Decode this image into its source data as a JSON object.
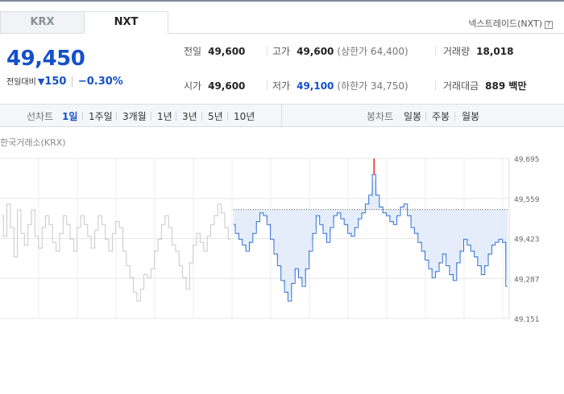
{
  "tabs": [
    {
      "label": "KRX",
      "active": false
    },
    {
      "label": "NXT",
      "active": true
    }
  ],
  "nxt_link": "넥스트레이드(NXT)",
  "help_icon_glyph": "?",
  "quote": {
    "price": "49,450",
    "change_label": "전일대비",
    "change_arrow": "▼",
    "change_amount": "150",
    "change_pct": "−0.30%",
    "color": "#1450c9"
  },
  "stats": {
    "prev_close": {
      "label": "전일",
      "value": "49,600"
    },
    "high": {
      "label": "고가",
      "value": "49,600",
      "sub": "(상한가 64,400)"
    },
    "volume": {
      "label": "거래량",
      "value": "18,018"
    },
    "open": {
      "label": "시가",
      "value": "49,600"
    },
    "low": {
      "label": "저가",
      "value": "49,100",
      "sub": "(하한가 34,750)"
    },
    "amount": {
      "label": "거래대금",
      "value": "889 백만"
    }
  },
  "controls": {
    "line_label": "선차트",
    "line_periods": [
      "1일",
      "1주일",
      "3개월",
      "1년",
      "3년",
      "5년",
      "10년"
    ],
    "selected_line_period": "1일",
    "candle_label": "봉차트",
    "candle_periods": [
      "일봉",
      "주봉",
      "월봉"
    ]
  },
  "market_label": "한국거래소(KRX)",
  "chart_data": {
    "type": "line",
    "ylim": [
      49151,
      49695
    ],
    "yticks": [
      "49,695",
      "49,559",
      "49,423",
      "49,287",
      "49,151"
    ],
    "grid": true,
    "colors": {
      "before": "#c8c8c8",
      "session": "#2f6fd6",
      "high_mark": "#e8212e",
      "fill": "#dfeaf8"
    },
    "series": [
      {
        "values": [
          49500,
          49430,
          49540,
          49460,
          49360,
          49520,
          49440,
          49400,
          49470,
          49520,
          49430,
          49390,
          49460,
          49500,
          49470,
          49410,
          49380,
          49440,
          49500,
          49470,
          49420,
          49380,
          49460,
          49500,
          49470,
          49430,
          49390,
          49450,
          49500,
          49470,
          49420,
          49380,
          49440,
          49480,
          49460,
          49380,
          49330,
          49290,
          49240,
          49210,
          49250,
          49300,
          49290,
          49320,
          49380,
          49420,
          49470,
          49500,
          49460,
          49400,
          49380,
          49330,
          49290,
          49250,
          49340,
          49400,
          49440,
          49410,
          49380,
          49430,
          49470,
          49500,
          49540,
          49510,
          49460,
          49420
        ]
      },
      {
        "values": [
          49470,
          49440,
          49420,
          49400,
          49380,
          49410,
          49440,
          49480,
          49510,
          49500,
          49470,
          49420,
          49370,
          49330,
          49280,
          49240,
          49210,
          49270,
          49320,
          49290,
          49260,
          49320,
          49380,
          49440,
          49500,
          49470,
          49440,
          49410,
          49460,
          49500,
          49510,
          49490,
          49470,
          49440,
          49430,
          49460,
          49490,
          49510,
          49540,
          49570,
          49640,
          49570,
          49530,
          49510,
          49500,
          49480,
          49470,
          49500,
          49530,
          49540,
          49500,
          49460,
          49440,
          49410,
          49380,
          49350,
          49320,
          49290,
          49310,
          49340,
          49370,
          49330,
          49300,
          49280,
          49340,
          49380,
          49420,
          49400,
          49380,
          49360,
          49330,
          49300,
          49330,
          49370,
          49400,
          49410,
          49420,
          49410,
          49260
        ]
      },
      {
        "values": [
          49521
        ]
      }
    ]
  }
}
